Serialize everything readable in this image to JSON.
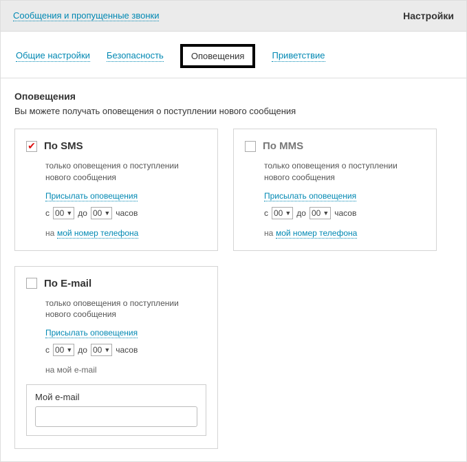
{
  "header": {
    "breadcrumb": "Сообщения и пропущенные звонки",
    "settings": "Настройки"
  },
  "tabs": {
    "general": "Общие настройки",
    "security": "Безопасность",
    "notifications": "Оповещения",
    "greeting": "Приветствие"
  },
  "section": {
    "title": "Оповещения",
    "desc": "Вы можете получать оповещения о поступлении нового сообщения"
  },
  "labels": {
    "from": "с",
    "to": "до",
    "hours": "часов",
    "to_prefix": "на",
    "to_my": "на мой",
    "time00": "00"
  },
  "sms": {
    "title": "По SMS",
    "sub": "только оповещения о поступлении нового сообщения",
    "send": "Присылать оповещения",
    "link": "мой номер телефона"
  },
  "mms": {
    "title": "По MMS",
    "sub": "только оповещения о поступлении нового сообщения",
    "send": "Присылать оповещения",
    "link": "мой номер телефона"
  },
  "email": {
    "title": "По E-mail",
    "sub": "только оповещения о поступлении нового сообщения",
    "send": "Присылать оповещения",
    "suffix": "e-mail",
    "field_label": "Мой e-mail"
  }
}
